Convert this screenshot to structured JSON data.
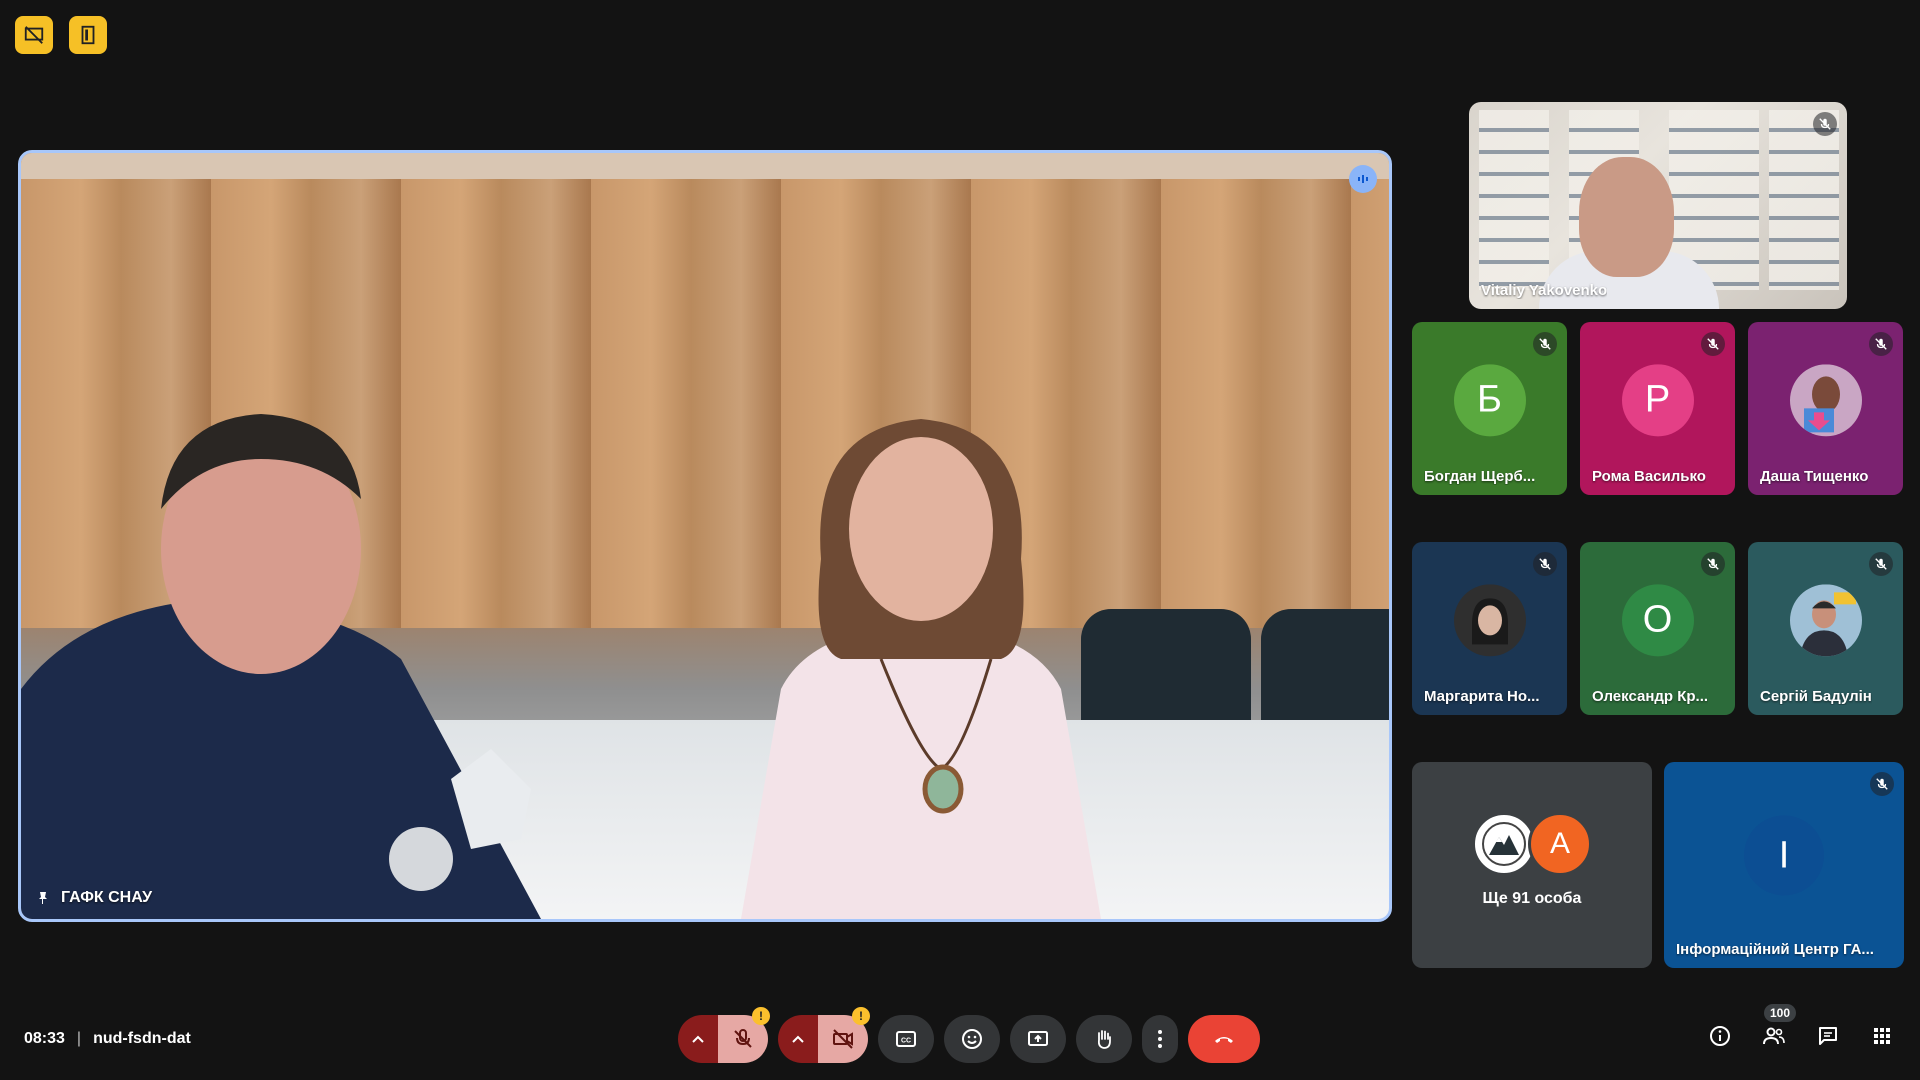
{
  "icons": {
    "badge_1": "presentation-off-icon",
    "badge_2": "door-exit-icon"
  },
  "main_tile": {
    "name": "ГАФК СНАУ",
    "speaking": true
  },
  "preview_tile": {
    "name": "Vitaliy Yakovenko",
    "muted": true
  },
  "participants": [
    {
      "name": "Богдан Щерб...",
      "initial": "Б",
      "bg": "#3a7a2a",
      "avatar_bg": "#5aa93f",
      "muted": true
    },
    {
      "name": "Рома Василько",
      "initial": "Р",
      "bg": "#b1165c",
      "avatar_bg": "#e43f86",
      "muted": true
    },
    {
      "name": "Даша Тищенко",
      "initial": "",
      "bg": "#7b2270",
      "avatar_bg": "#b35aa6",
      "muted": true
    },
    {
      "name": "Маргарита Но...",
      "initial": "",
      "bg": "#1b3653",
      "avatar_bg": "#3a3a3a",
      "muted": true
    },
    {
      "name": "Олександр Кр...",
      "initial": "О",
      "bg": "#2c6b3a",
      "avatar_bg": "#2f8a45",
      "muted": true
    },
    {
      "name": "Сергій Бадулін",
      "initial": "",
      "bg": "#2b5a5e",
      "avatar_bg": "#8fb3c9",
      "muted": true
    }
  ],
  "others_tile": {
    "label": "Ще 91 особа",
    "avatar_initial": "А",
    "avatar_bg": "#f16522"
  },
  "info_tile": {
    "name": "Інформаційний Центр ГА...",
    "initial": "І",
    "bg": "#0b5394",
    "avatar_bg": "#0c4e93",
    "muted": true
  },
  "meeting": {
    "time": "08:33",
    "code": "nud-fsdn-dat"
  },
  "people_count": "100",
  "colors": {
    "end_call": "#ea4335",
    "muted_ctrl": "#e6a8a4",
    "warning": "#fbc02d",
    "speaking_border": "#a8c7fa"
  }
}
